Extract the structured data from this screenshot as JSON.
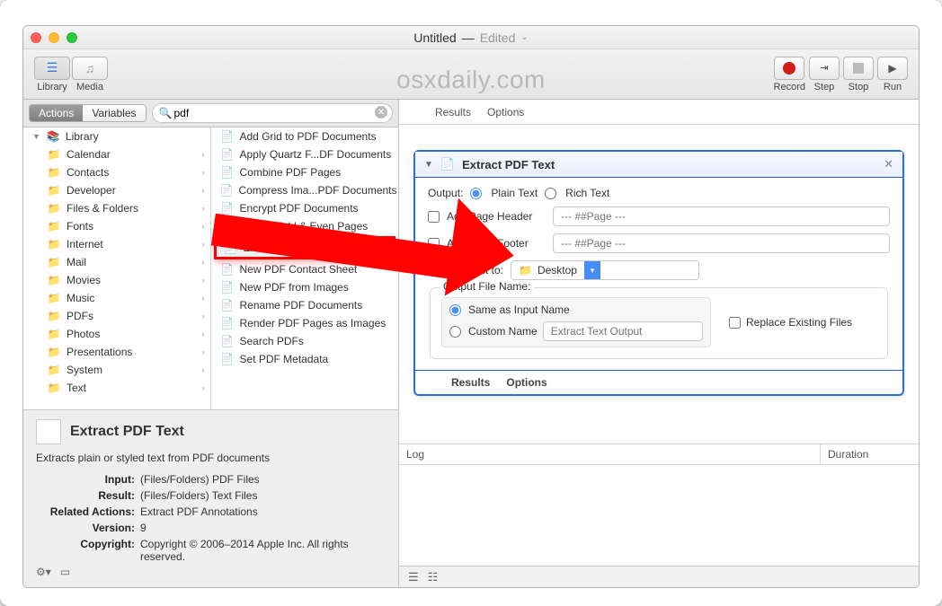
{
  "window": {
    "title": "Untitled",
    "edited": "Edited",
    "watermark": "osxdaily.com"
  },
  "toolbar": {
    "library": "Library",
    "media": "Media",
    "record": "Record",
    "step": "Step",
    "stop": "Stop",
    "run": "Run"
  },
  "tabs": {
    "actions": "Actions",
    "variables": "Variables"
  },
  "search": {
    "value": "pdf"
  },
  "library": {
    "root": "Library",
    "items": [
      "Calendar",
      "Contacts",
      "Developer",
      "Files & Folders",
      "Fonts",
      "Internet",
      "Mail",
      "Movies",
      "Music",
      "PDFs",
      "Photos",
      "Presentations",
      "System",
      "Text"
    ]
  },
  "actions_list": [
    "Add Grid to PDF Documents",
    "Apply Quartz F...DF Documents",
    "Combine PDF Pages",
    "Compress Ima...PDF Documents",
    "Encrypt PDF Documents",
    "Extract Odd & Even Pages",
    "Extract PDF Text",
    "New PDF Contact Sheet",
    "New PDF from Images",
    "Rename PDF Documents",
    "Render PDF Pages as Images",
    "Search PDFs",
    "Set PDF Metadata"
  ],
  "actions_selected_index": 6,
  "info": {
    "title": "Extract PDF Text",
    "desc": "Extracts plain or styled text from PDF documents",
    "rows": {
      "Input": "(Files/Folders) PDF Files",
      "Result": "(Files/Folders) Text Files",
      "Related Actions": "Extract PDF Annotations",
      "Version": "9",
      "Copyright": "Copyright © 2006–2014 Apple Inc. All rights reserved."
    }
  },
  "workflow_tabs": {
    "results": "Results",
    "options": "Options"
  },
  "action_card": {
    "title": "Extract PDF Text",
    "output_label": "Output:",
    "plain": "Plain Text",
    "rich": "Rich Text",
    "add_header": "Add Page Header",
    "add_footer": "Add Page Footer",
    "page_placeholder": "--- ##Page ---",
    "save_to_label": "Save Output to:",
    "save_to_value": "Desktop",
    "filename_group": "Output File Name:",
    "same_name": "Same as Input Name",
    "custom_name": "Custom Name",
    "custom_placeholder": "Extract Text Output",
    "replace": "Replace Existing Files",
    "footer_results": "Results",
    "footer_options": "Options"
  },
  "log": {
    "log": "Log",
    "duration": "Duration"
  }
}
